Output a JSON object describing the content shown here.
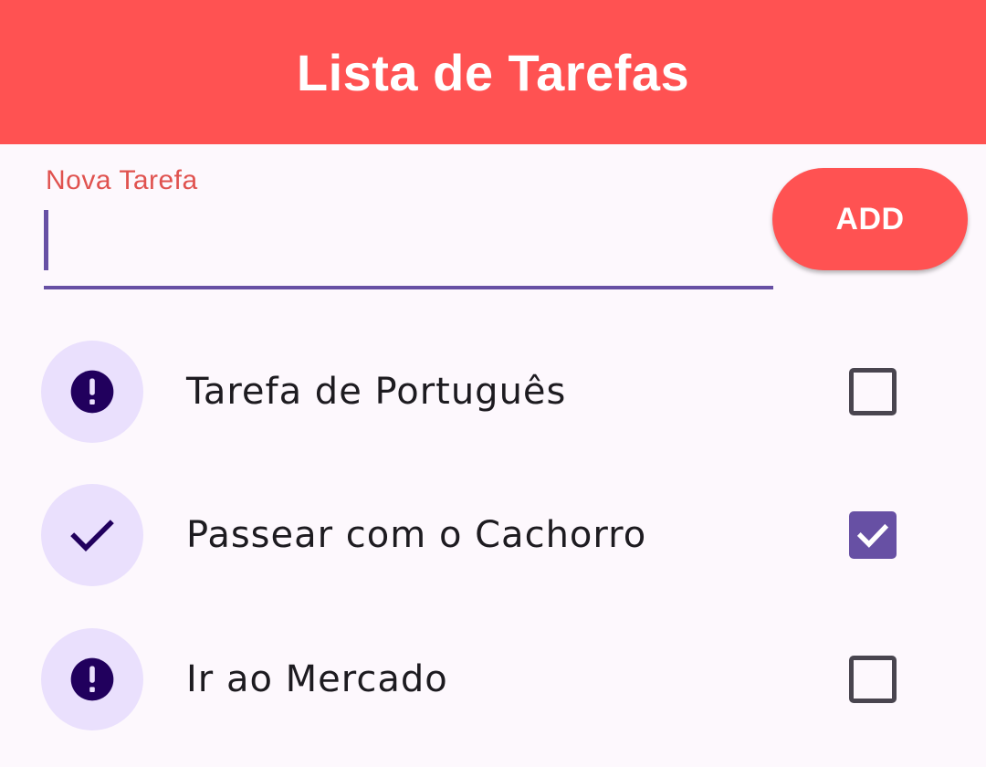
{
  "appbar": {
    "title": "Lista de Tarefas"
  },
  "new_task": {
    "label": "Nova Tarefa",
    "value": "",
    "add_label": "ADD"
  },
  "tasks": [
    {
      "label": "Tarefa de Português",
      "done": false,
      "icon": "error-icon"
    },
    {
      "label": "Passear com o Cachorro",
      "done": true,
      "icon": "check-icon"
    },
    {
      "label": "Ir ao Mercado",
      "done": false,
      "icon": "error-icon"
    }
  ],
  "colors": {
    "primary": "#ff5252",
    "accent": "#6750a4",
    "avatar_bg": "#eae0fd",
    "avatar_fg": "#21005d"
  }
}
